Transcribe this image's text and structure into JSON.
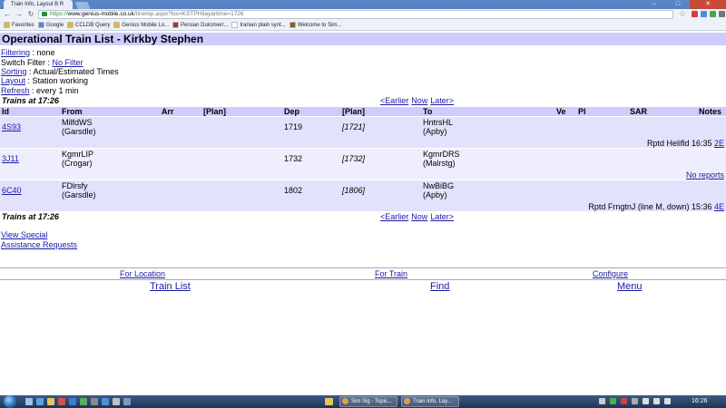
{
  "browser": {
    "tab_title": "Train Info, Layout B R",
    "url_scheme": "https://",
    "url_host": "www.genius-mobile.co.uk",
    "url_path": "/tinerep.aspx?loc=KSTPHilayartime=1726",
    "bookmarks": [
      {
        "label": "Favorites",
        "color": "#e9b53a"
      },
      {
        "label": "Google",
        "color": "#4a86e8"
      },
      {
        "label": "CCLDB Query",
        "color": "#e9b53a"
      },
      {
        "label": "Genius Mobile Lo...",
        "color": "#e9b53a"
      },
      {
        "label": "Persian Dulcimer/...",
        "color": "#b03030"
      },
      {
        "label": "Iranian plain synt...",
        "color": "#ffffff"
      },
      {
        "label": "Welcome to Sim...",
        "color": "#8a5a2a"
      }
    ]
  },
  "page": {
    "title": "Operational Train List - Kirkby Stephen",
    "options": {
      "filtering_link": "Filtering",
      "filtering_value": " : none",
      "switch_label": "Switch Filter : ",
      "switch_link": "No Filter",
      "sorting_link": "Sorting",
      "sorting_value": " : Actual/Estimated Times",
      "layout_link": "Layout",
      "layout_value": " : Station working",
      "refresh_link": "Refresh",
      "refresh_value": " : every 1 min"
    },
    "trains_at": "Trains at 17:26",
    "nav": {
      "earlier": "<Earlier",
      "now": "Now",
      "later": "Later>"
    },
    "columns": {
      "id": "Id",
      "from": "From",
      "arr": "Arr",
      "arr_plan": "[Plan]",
      "dep": "Dep",
      "dep_plan": "[Plan]",
      "to": "To",
      "ve": "Ve",
      "pl": "Pl",
      "sar": "SAR",
      "notes": "Notes"
    },
    "trains": [
      {
        "id": "4S93",
        "from": "MilfdWS",
        "from_sub": "(Garsdle)",
        "dep": "1719",
        "dep_plan": "[1721]",
        "to": "HntrsHL",
        "to_sub": "(Apby)",
        "report": "Rptd Helifld 16:35 ",
        "report_link": "2E"
      },
      {
        "id": "3J11",
        "from": "KgmrLIP",
        "from_sub": "(Crogar)",
        "dep": "1732",
        "dep_plan": "[1732]",
        "to": "KgmrDRS",
        "to_sub": "(Malrstg)",
        "report": "",
        "report_link": "No reports"
      },
      {
        "id": "6C40",
        "from": "FDlrsfy",
        "from_sub": "(Garsdle)",
        "dep": "1802",
        "dep_plan": "[1806]",
        "to": "NwBiBG",
        "to_sub": "(Apby)",
        "report": "Rptd FrngtnJ (line M, down) 15:36 ",
        "report_link": "4E"
      }
    ],
    "links": {
      "view_special": "View Special",
      "assistance": "Assistance Requests"
    },
    "footer": {
      "for_location": "For Location",
      "for_train": "For Train",
      "configure": "Configure",
      "train_list": "Train List",
      "find": "Find",
      "menu": "Menu"
    }
  },
  "taskbar": {
    "tasks": [
      "Sim Sig - Topic...",
      "Train Info, Lay..."
    ],
    "clock": "16:26"
  },
  "colors": {
    "header_band": "#ccccff",
    "row_light": "#e2e2fd",
    "row_lighter": "#eeeefe",
    "link": "#1a1aa6"
  }
}
